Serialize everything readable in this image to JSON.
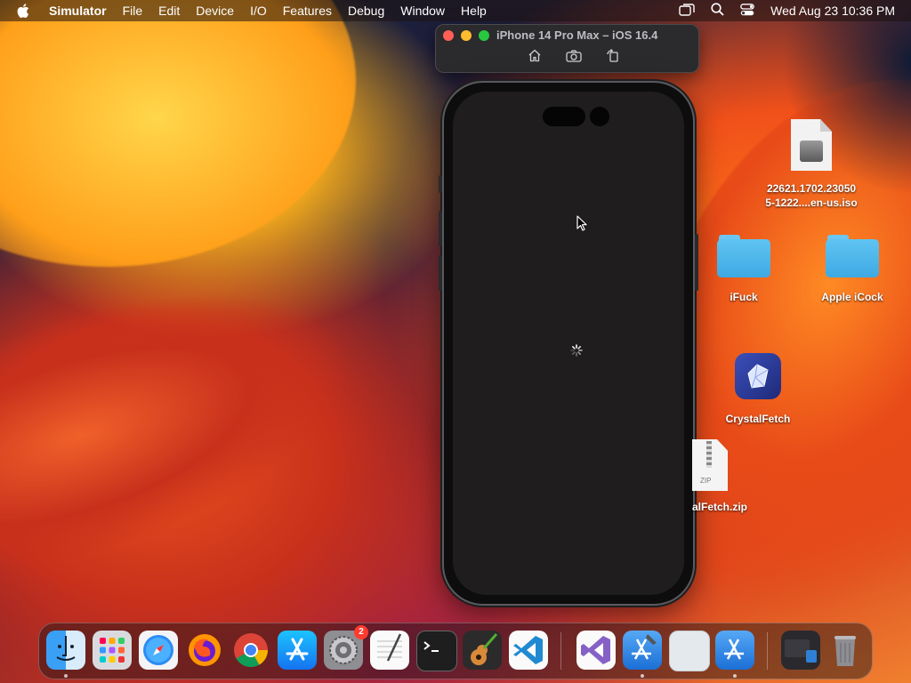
{
  "menubar": {
    "app_name": "Simulator",
    "menus": [
      "File",
      "Edit",
      "Device",
      "I/O",
      "Features",
      "Debug",
      "Window",
      "Help"
    ],
    "clock": "Wed Aug 23  10:36 PM"
  },
  "simulator": {
    "window_title": "iPhone 14 Pro Max – iOS 16.4"
  },
  "desktop": {
    "icons": [
      {
        "name": "22621.1702.230505-1222....en-us.iso",
        "line1": "22621.1702.23050",
        "line2": "5-1222....en-us.iso",
        "kind": "disk-image"
      },
      {
        "name": "iFuck",
        "kind": "folder"
      },
      {
        "name": "Apple iCock",
        "kind": "folder"
      },
      {
        "name": "CrystalFetch",
        "kind": "app"
      },
      {
        "name": "alFetch.zip",
        "kind": "zip",
        "zip_label": "ZIP"
      }
    ]
  },
  "dock": {
    "apps": [
      "Finder",
      "Launchpad",
      "Safari",
      "Firefox",
      "Google Chrome",
      "App Store",
      "System Settings",
      "TextEdit",
      "Terminal",
      "GarageBand",
      "Visual Studio Code",
      "Visual Studio",
      "Xcode",
      "Preview",
      "Simulator",
      "Window Switcher",
      "Trash"
    ],
    "settings_badge": "2"
  },
  "colors": {
    "accent_folder": "#4fb8ec",
    "badge": "#ff3b30",
    "traffic_red": "#fe5f57",
    "traffic_yellow": "#febc2e",
    "traffic_green": "#28c840"
  }
}
